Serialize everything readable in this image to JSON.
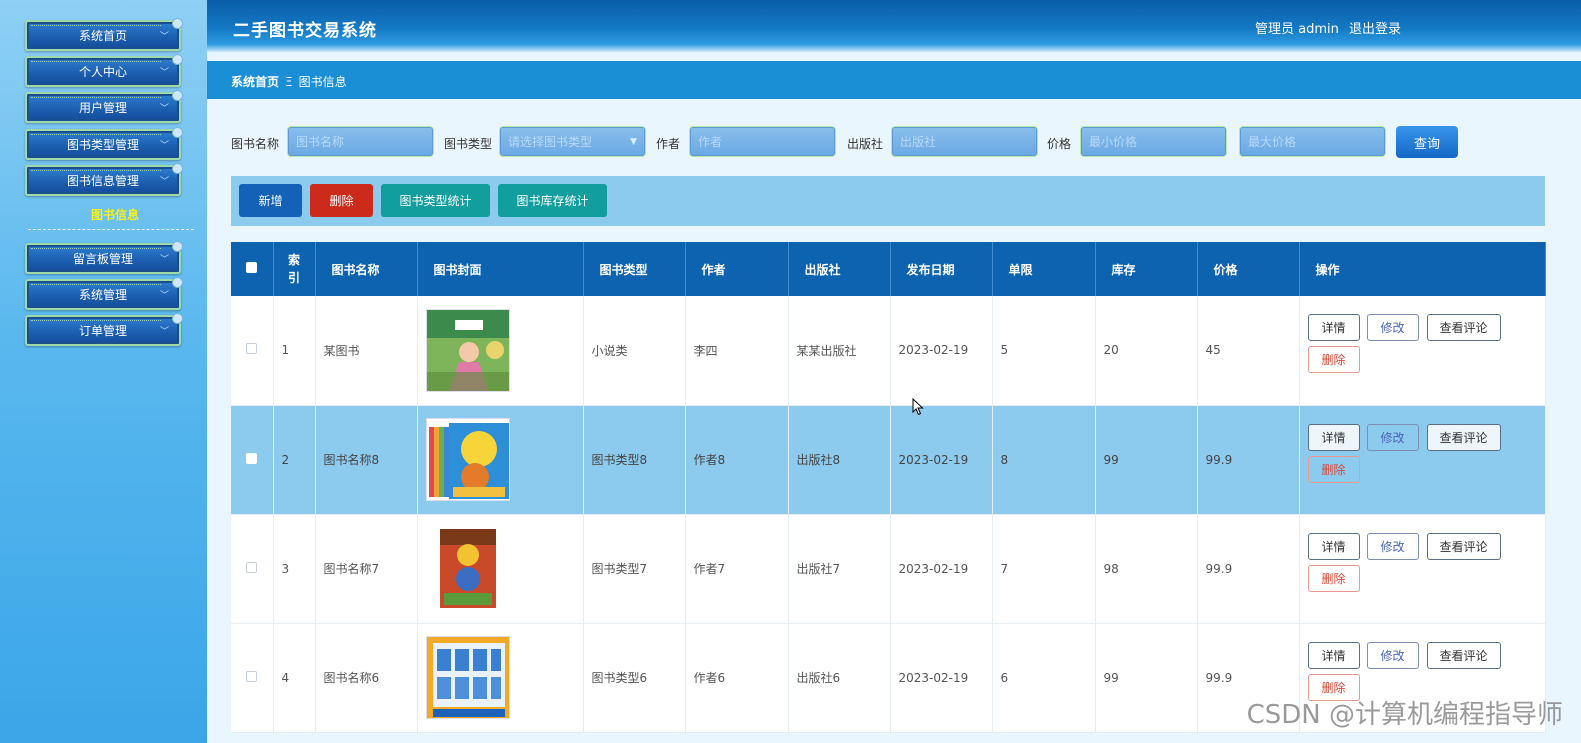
{
  "app": {
    "title": "二手图书交易系统",
    "role_user": "管理员 admin",
    "logout": "退出登录"
  },
  "sidebar": {
    "items": [
      {
        "label": "系统首页"
      },
      {
        "label": "个人中心"
      },
      {
        "label": "用户管理"
      },
      {
        "label": "图书类型管理"
      },
      {
        "label": "图书信息管理"
      },
      {
        "label": "留言板管理"
      },
      {
        "label": "系统管理"
      },
      {
        "label": "订单管理"
      }
    ],
    "active_sub": "图书信息"
  },
  "breadcrumb": {
    "home": "系统首页",
    "separator": "Ξ",
    "current": "图书信息"
  },
  "search": {
    "name_label": "图书名称",
    "name_placeholder": "图书名称",
    "type_label": "图书类型",
    "type_placeholder": "请选择图书类型",
    "author_label": "作者",
    "author_placeholder": "作者",
    "publisher_label": "出版社",
    "publisher_placeholder": "出版社",
    "price_label": "价格",
    "price_min_placeholder": "最小价格",
    "price_max_placeholder": "最大价格",
    "query_label": "查询"
  },
  "toolbar": {
    "add": "新增",
    "delete": "删除",
    "type_stats": "图书类型统计",
    "stock_stats": "图书库存统计"
  },
  "table": {
    "headers": {
      "index": "索\n引",
      "name": "图书名称",
      "cover": "图书封面",
      "type": "图书类型",
      "author": "作者",
      "publisher": "出版社",
      "date": "发布日期",
      "limit": "单限",
      "stock": "库存",
      "price": "价格",
      "ops": "操作"
    },
    "rows": [
      {
        "index": "1",
        "name": "某图书",
        "type": "小说类",
        "author": "李四",
        "publisher": "某某出版社",
        "date": "2023-02-19",
        "limit": "5",
        "stock": "20",
        "price": "45"
      },
      {
        "index": "2",
        "name": "图书名称8",
        "type": "图书类型8",
        "author": "作者8",
        "publisher": "出版社8",
        "date": "2023-02-19",
        "limit": "8",
        "stock": "99",
        "price": "99.9"
      },
      {
        "index": "3",
        "name": "图书名称7",
        "type": "图书类型7",
        "author": "作者7",
        "publisher": "出版社7",
        "date": "2023-02-19",
        "limit": "7",
        "stock": "98",
        "price": "99.9"
      },
      {
        "index": "4",
        "name": "图书名称6",
        "type": "图书类型6",
        "author": "作者6",
        "publisher": "出版社6",
        "date": "2023-02-19",
        "limit": "6",
        "stock": "99",
        "price": "99.9"
      }
    ],
    "ops": {
      "detail": "详情",
      "edit": "修改",
      "comment": "查看评论",
      "delete": "删除"
    }
  },
  "watermark": "CSDN @计算机编程指导师"
}
